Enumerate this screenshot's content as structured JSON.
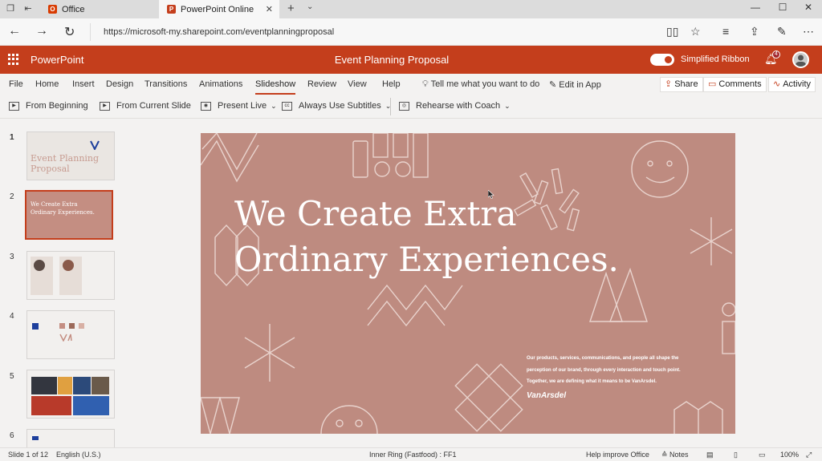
{
  "browser": {
    "tabs": [
      {
        "label": "Office",
        "active": false
      },
      {
        "label": "PowerPoint Online",
        "active": true
      }
    ],
    "url": "https://microsoft-my.sharepoint.com/eventplanningproposal"
  },
  "app": {
    "name": "PowerPoint",
    "doc_title": "Event Planning Proposal",
    "toggle_label": "Simplified Ribbon",
    "notification_count": "4"
  },
  "ribbon": {
    "menu": [
      "File",
      "Home",
      "Insert",
      "Design",
      "Transitions",
      "Animations",
      "Slideshow",
      "Review",
      "View",
      "Help"
    ],
    "active_menu": "Slideshow",
    "tell_me": "Tell me what you want to do",
    "edit_in_app": "Edit in App",
    "share": "Share",
    "comments": "Comments",
    "activity": "Activity",
    "tools": {
      "from_beginning": "From Beginning",
      "from_current": "From Current Slide",
      "present_live": "Present Live",
      "subtitles": "Always Use Subtitles",
      "rehearse": "Rehearse with Coach"
    }
  },
  "thumbnails": [
    {
      "num": "1",
      "title": "Event Planning Proposal"
    },
    {
      "num": "2",
      "title": "We Create Extra Ordinary Experiences."
    },
    {
      "num": "3"
    },
    {
      "num": "4"
    },
    {
      "num": "5"
    },
    {
      "num": "6"
    }
  ],
  "slide": {
    "heading_line1": "We Create Extra",
    "heading_line2": "Ordinary Experiences.",
    "body_line1": "Our products, services, communications, and people all shape the",
    "body_line2": "perception of our brand, through every interaction and touch point.",
    "body_line3": "Together, we are defining what it means to be VanArsdel.",
    "logo": "VanArsdel"
  },
  "status": {
    "slide_info": "Slide 1 of 12",
    "language": "English (U.S.)",
    "ring": "Inner Ring (Fastfood) : FF1",
    "help": "Help improve Office",
    "notes": "Notes",
    "zoom": "100%"
  },
  "colors": {
    "brand": "#c43e1c",
    "slide_bg": "#be8b80"
  }
}
